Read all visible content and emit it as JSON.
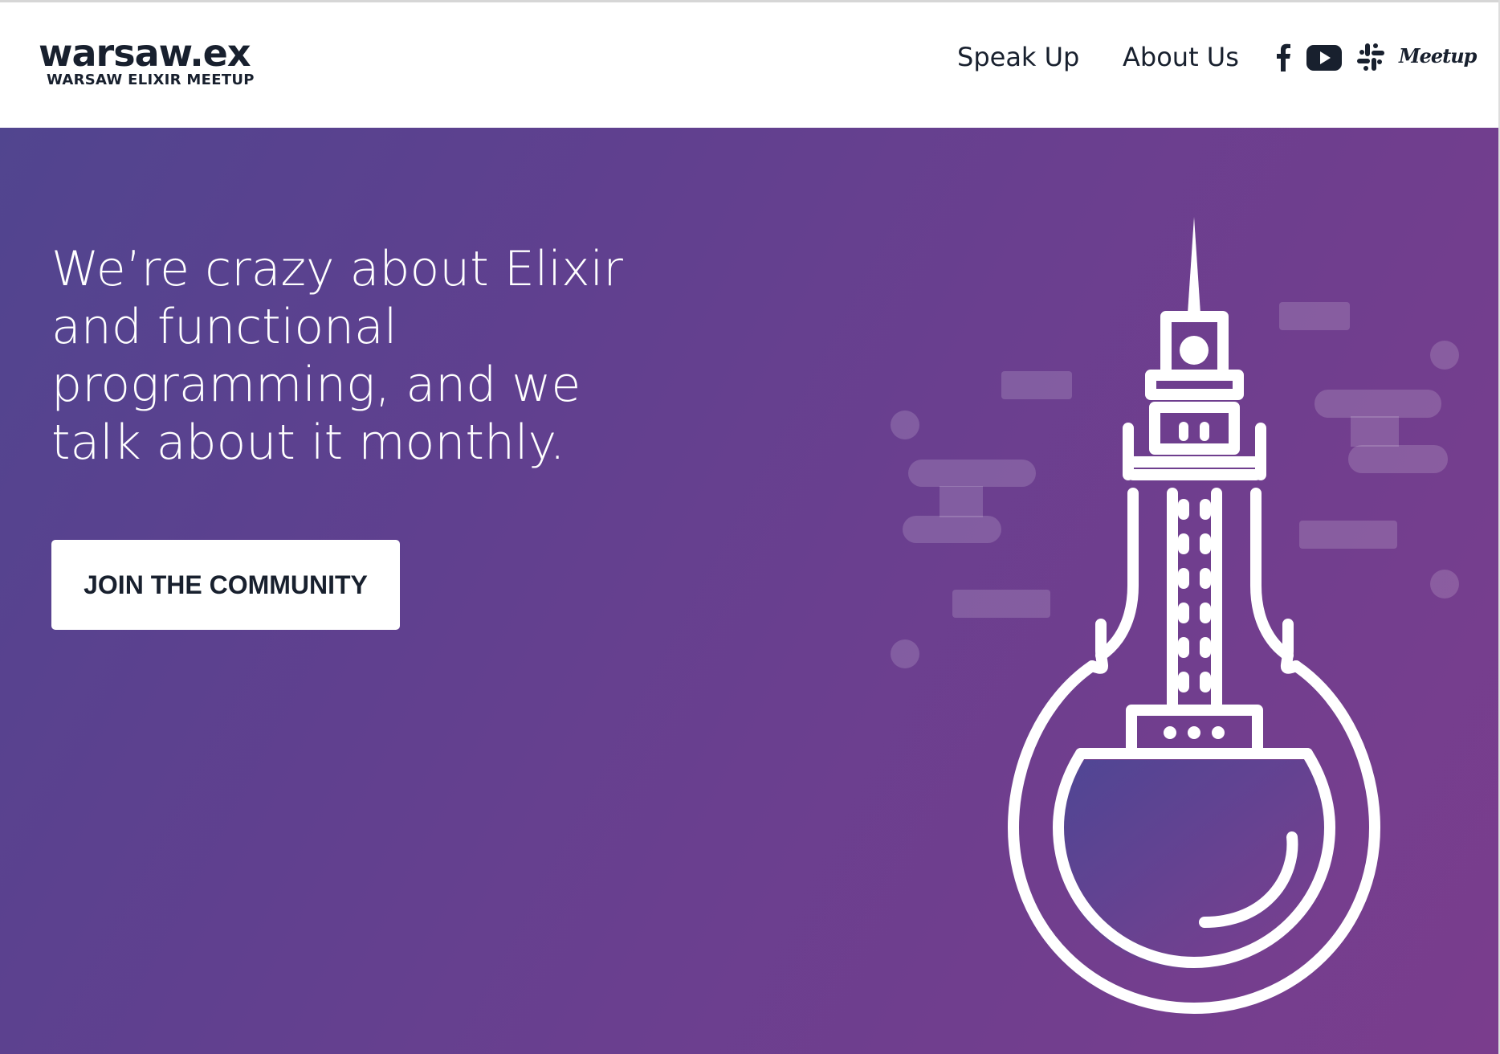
{
  "header": {
    "logo_main": "warsaw.ex",
    "logo_sub": "WARSAW ELIXIR MEETUP",
    "nav": [
      {
        "label": "Speak Up"
      },
      {
        "label": "About Us"
      }
    ],
    "social": {
      "facebook_icon": "facebook-icon",
      "youtube_icon": "youtube-icon",
      "slack_icon": "slack-icon",
      "meetup_label": "Meetup"
    }
  },
  "hero": {
    "headline_lines": [
      "We’re crazy about Elixir",
      "and functional",
      "programming, and we",
      "talk about it monthly."
    ],
    "cta_label": "JOIN THE COMMUNITY",
    "illustration_icon": "palace-of-culture-flask-illustration"
  },
  "colors": {
    "text_dark": "#18202e",
    "gradient_start": "#51458f",
    "gradient_end": "#7a3d8d",
    "white": "#ffffff"
  }
}
